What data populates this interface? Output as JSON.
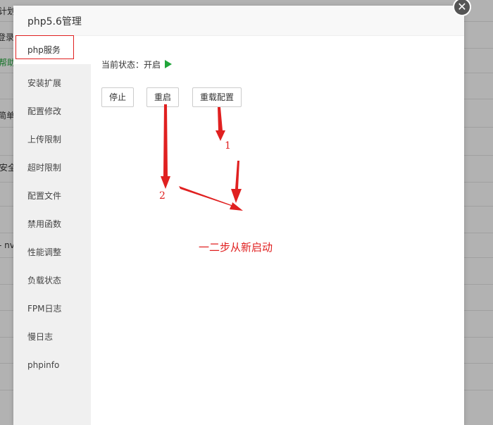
{
  "background": {
    "labels": [
      {
        "text": "计划",
        "class": ""
      },
      {
        "text": "登录",
        "class": ""
      },
      {
        "text": "帮助",
        "class": "green"
      },
      {
        "text": "简单",
        "class": ""
      },
      {
        "text": "安全",
        "class": ""
      },
      {
        "text": "- nv",
        "class": ""
      }
    ]
  },
  "dialog": {
    "title": "php5.6管理",
    "close_icon": "✕"
  },
  "sidebar": {
    "items": [
      {
        "label": "php服务",
        "active": true
      },
      {
        "label": "安装扩展"
      },
      {
        "label": "配置修改"
      },
      {
        "label": "上传限制"
      },
      {
        "label": "超时限制"
      },
      {
        "label": "配置文件"
      },
      {
        "label": "禁用函数"
      },
      {
        "label": "性能调整"
      },
      {
        "label": "负载状态"
      },
      {
        "label": "FPM日志"
      },
      {
        "label": "慢日志"
      },
      {
        "label": "phpinfo"
      }
    ]
  },
  "main": {
    "status_label": "当前状态：开启",
    "status_color": "#20a53a",
    "buttons": {
      "stop": "停止",
      "restart": "重启",
      "reload": "重载配置"
    }
  },
  "annotations": {
    "num1": "1",
    "num2": "2",
    "note": "一二步从新启动",
    "color": "#e02020"
  }
}
